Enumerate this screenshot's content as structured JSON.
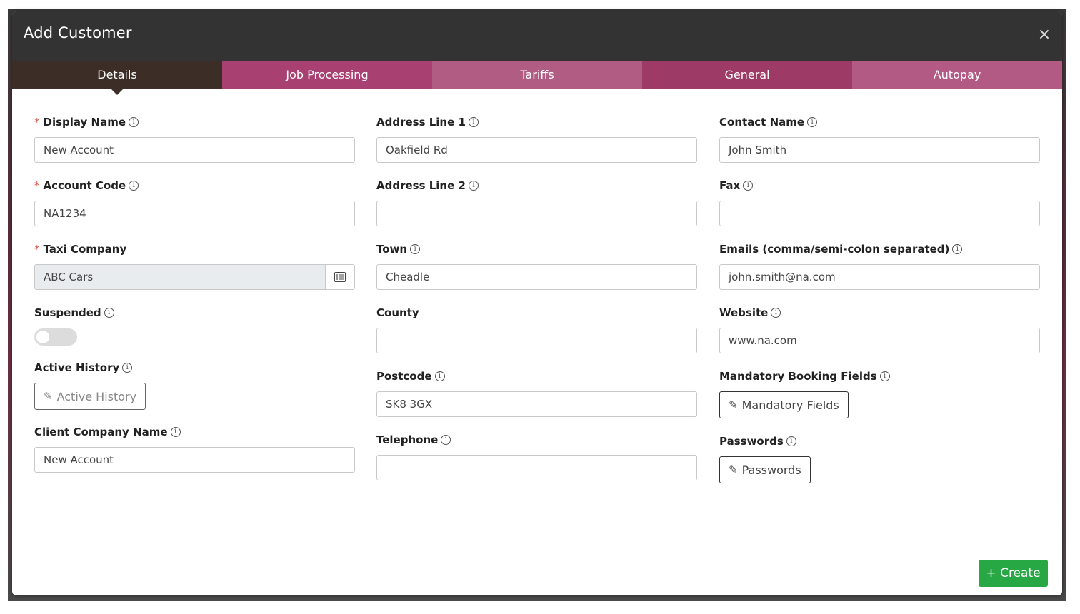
{
  "modal": {
    "title": "Add Customer",
    "close_glyph": "×"
  },
  "tabs": [
    {
      "label": "Details",
      "active": true
    },
    {
      "label": "Job Processing"
    },
    {
      "label": "Tariffs"
    },
    {
      "label": "General"
    },
    {
      "label": "Autopay"
    }
  ],
  "col1": {
    "display_name": {
      "label": "Display Name",
      "value": "New Account",
      "required": true
    },
    "account_code": {
      "label": "Account Code",
      "value": "NA1234",
      "required": true
    },
    "taxi_company": {
      "label": "Taxi Company",
      "value": "ABC Cars",
      "required": true
    },
    "suspended": {
      "label": "Suspended",
      "on": false
    },
    "active_history": {
      "label": "Active History",
      "button": "Active History"
    },
    "client_company_name": {
      "label": "Client Company Name",
      "value": "New Account"
    }
  },
  "col2": {
    "address1": {
      "label": "Address Line 1",
      "value": "Oakfield Rd"
    },
    "address2": {
      "label": "Address Line 2",
      "value": ""
    },
    "town": {
      "label": "Town",
      "value": "Cheadle"
    },
    "county": {
      "label": "County",
      "value": ""
    },
    "postcode": {
      "label": "Postcode",
      "value": "SK8 3GX"
    },
    "telephone": {
      "label": "Telephone",
      "value": ""
    }
  },
  "col3": {
    "contact_name": {
      "label": "Contact Name",
      "value": "John Smith"
    },
    "fax": {
      "label": "Fax",
      "value": ""
    },
    "emails": {
      "label": "Emails (comma/semi-colon separated)",
      "value": "john.smith@na.com"
    },
    "website": {
      "label": "Website",
      "value": "www.na.com"
    },
    "mandatory": {
      "label": "Mandatory Booking Fields",
      "button": "Mandatory Fields"
    },
    "passwords": {
      "label": "Passwords",
      "button": "Passwords"
    }
  },
  "footer": {
    "create_label": "+ Create"
  },
  "icons": {
    "info": "i",
    "required": "*",
    "pencil": "✎",
    "list": "list-icon"
  },
  "colors": {
    "header_bg": "#333333",
    "tab_active": "#3c2e27",
    "tab_pink": "#a84071",
    "required": "#d9534f",
    "create": "#28a745"
  }
}
